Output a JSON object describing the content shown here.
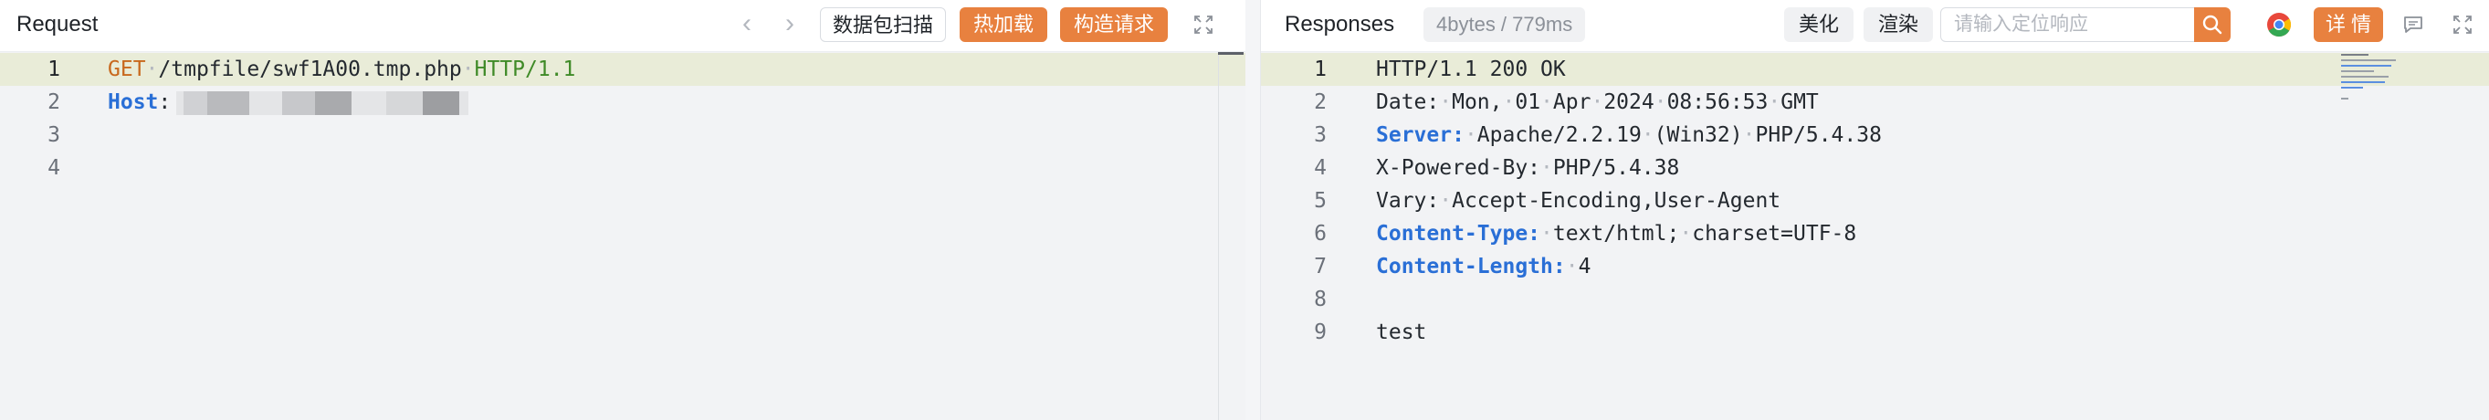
{
  "request": {
    "title": "Request",
    "buttons": {
      "scan": "数据包扫描",
      "hot_load": "热加载",
      "build_request": "构造请求"
    },
    "lines": [
      {
        "num": "1",
        "method": "GET",
        "path": "/tmpfile/swf1A00.tmp.php",
        "protocol": "HTTP/1.1"
      },
      {
        "num": "2",
        "header": "Host",
        "value": ""
      },
      {
        "num": "3"
      },
      {
        "num": "4"
      }
    ]
  },
  "response": {
    "title": "Responses",
    "size_badge": "4bytes / 779ms",
    "buttons": {
      "beautify": "美化",
      "render": "渲染",
      "details": "详 情"
    },
    "search": {
      "placeholder": "请输入定位响应"
    },
    "lines": [
      {
        "num": "1",
        "text": "HTTP/1.1 200 OK"
      },
      {
        "num": "2",
        "key": "Date:",
        "value": "Mon, 01 Apr 2024 08:56:53 GMT"
      },
      {
        "num": "3",
        "key": "Server:",
        "value": "Apache/2.2.19 (Win32) PHP/5.4.38",
        "highlight": true
      },
      {
        "num": "4",
        "key": "X-Powered-By:",
        "value": "PHP/5.4.38"
      },
      {
        "num": "5",
        "key": "Vary:",
        "value": "Accept-Encoding,User-Agent"
      },
      {
        "num": "6",
        "key": "Content-Type:",
        "value": "text/html; charset=UTF-8",
        "highlight": true
      },
      {
        "num": "7",
        "key": "Content-Length:",
        "value": "4",
        "highlight": true
      },
      {
        "num": "8",
        "text": ""
      },
      {
        "num": "9",
        "text": "test"
      }
    ]
  },
  "colors": {
    "accent_orange": "#e8813f",
    "header_blue": "#2a6fd6",
    "method_orange": "#c8681d",
    "protocol_green": "#3f8a27",
    "active_line": "#e9ecd8"
  },
  "icons": {
    "prev": "chevron-left-icon",
    "next": "chevron-right-icon",
    "expand": "fullscreen-icon",
    "search": "search-icon",
    "chrome": "chrome-icon",
    "comment": "comment-icon"
  }
}
